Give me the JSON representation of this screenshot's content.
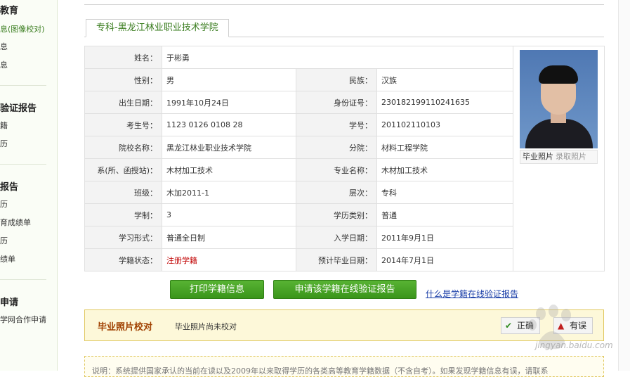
{
  "sidebar": {
    "sections": [
      {
        "heading": "教育",
        "items": [
          "息(图像校对)",
          "息",
          "息"
        ]
      },
      {
        "heading": "验证报告",
        "items": [
          "籍",
          "历"
        ]
      },
      {
        "heading": "报告",
        "items": [
          "历",
          "育成绩单",
          "历",
          "绩单"
        ]
      },
      {
        "heading": "申请",
        "items": [
          "学网合作申请"
        ]
      }
    ]
  },
  "tab": {
    "label": "专科-黑龙江林业职业技术学院"
  },
  "student": {
    "name_label": "姓名：",
    "name": "于彬勇",
    "gender_label": "性别：",
    "gender": "男",
    "ethnicity_label": "民族：",
    "ethnicity": "汉族",
    "birth_label": "出生日期：",
    "birth": "1991年10月24日",
    "id_label": "身份证号：",
    "id": "230182199110241635",
    "exam_no_label": "考生号：",
    "exam_no": "1123 0126 0108 28",
    "student_no_label": "学号：",
    "student_no": "201102110103",
    "school_label": "院校名称：",
    "school": "黑龙江林业职业技术学院",
    "branch_label": "分院：",
    "branch": "材料工程学院",
    "dept_label": "系(所、函授站)：",
    "dept": "木材加工技术",
    "major_label": "专业名称：",
    "major": "木材加工技术",
    "class_label": "班级：",
    "class": "木加2011-1",
    "level_label": "层次：",
    "level": "专科",
    "years_label": "学制：",
    "years": "3",
    "edu_type_label": "学历类别：",
    "edu_type": "普通",
    "study_form_label": "学习形式：",
    "study_form": "普通全日制",
    "entry_date_label": "入学日期：",
    "entry_date": "2011年9月1日",
    "status_label": "学籍状态：",
    "status": "注册学籍",
    "grad_date_label": "预计毕业日期：",
    "grad_date": "2014年7月1日"
  },
  "photo": {
    "caption_current": "毕业照片",
    "caption_alt": "录取照片"
  },
  "actions": {
    "print_label": "打印学籍信息",
    "apply_label": "申请该学籍在线验证报告",
    "help_link": "什么是学籍在线验证报告"
  },
  "verify": {
    "title": "毕业照片校对",
    "message": "毕业照片尚未校对",
    "correct_label": "正确",
    "error_label": "有误"
  },
  "note": {
    "text": "说明：系统提供国家承认的当前在读以及2009年以来取得学历的各类高等教育学籍数据（不含自考）。如果发现学籍信息有误，请联系"
  },
  "watermark": {
    "text": "jingyan.baidu.com"
  },
  "colors": {
    "accent_green": "#3a951a",
    "status_red": "#c00000",
    "link_blue": "#1a3ea8"
  }
}
